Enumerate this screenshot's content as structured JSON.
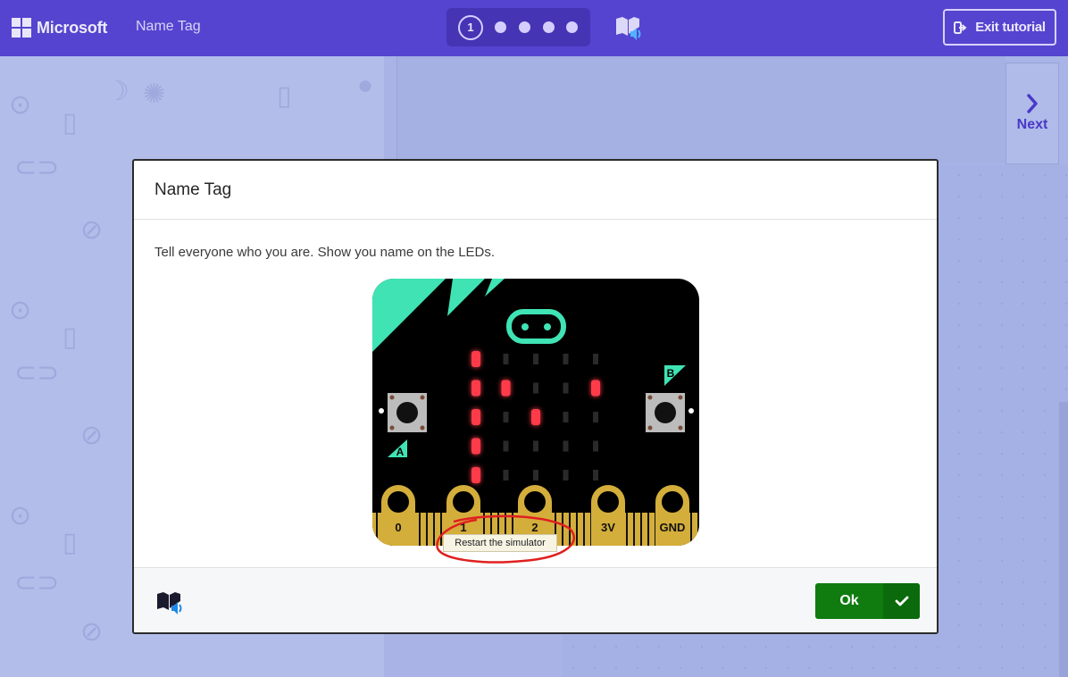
{
  "header": {
    "brand": "Microsoft",
    "tutorial_name": "Name Tag",
    "current_step": "1",
    "total_dots": 4,
    "exit_label": "Exit tutorial"
  },
  "side": {
    "next_label": "Next"
  },
  "dialog": {
    "title": "Name Tag",
    "text": "Tell everyone who you are. Show you name on the LEDs.",
    "ok_label": "Ok"
  },
  "microbit": {
    "button_a": "A",
    "button_b": "B",
    "pins": [
      "0",
      "1",
      "2",
      "3V",
      "GND"
    ],
    "led_matrix": [
      [
        1,
        0,
        0,
        0,
        0
      ],
      [
        1,
        1,
        0,
        0,
        1
      ],
      [
        1,
        0,
        1,
        0,
        0
      ],
      [
        1,
        0,
        0,
        0,
        0
      ],
      [
        1,
        0,
        0,
        0,
        0
      ]
    ]
  },
  "tooltip": "Restart the simulator",
  "colors": {
    "header": "#5544cf",
    "board": "#000000",
    "accent": "#3fe3b4",
    "led_on": "#ff3b48",
    "pin_gold": "#d4ae3b",
    "ok_green": "#107c10"
  }
}
